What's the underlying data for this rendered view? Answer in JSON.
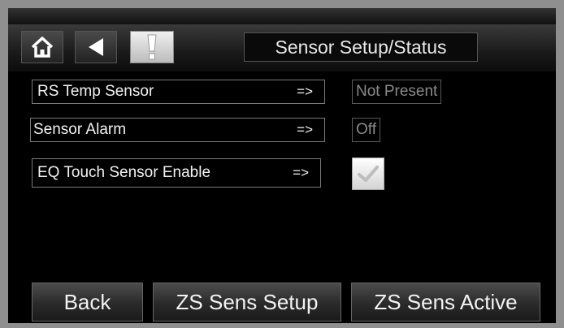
{
  "header": {
    "title": "Sensor Setup/Status",
    "home_icon": "home-icon",
    "back_icon": "left-triangle-icon",
    "alert_icon": "exclamation-icon"
  },
  "rows": [
    {
      "label": "RS Temp Sensor",
      "arrow": "=>",
      "value": "Not Present"
    },
    {
      "label": "Sensor Alarm",
      "arrow": "=>",
      "value": "Off"
    },
    {
      "label": "EQ Touch Sensor Enable",
      "arrow": "=>",
      "value_type": "checkbox",
      "checked": true
    }
  ],
  "footer": {
    "back_label": "Back",
    "zs_setup_label": "ZS Sens Setup",
    "zs_active_label": "ZS Sens Active"
  }
}
